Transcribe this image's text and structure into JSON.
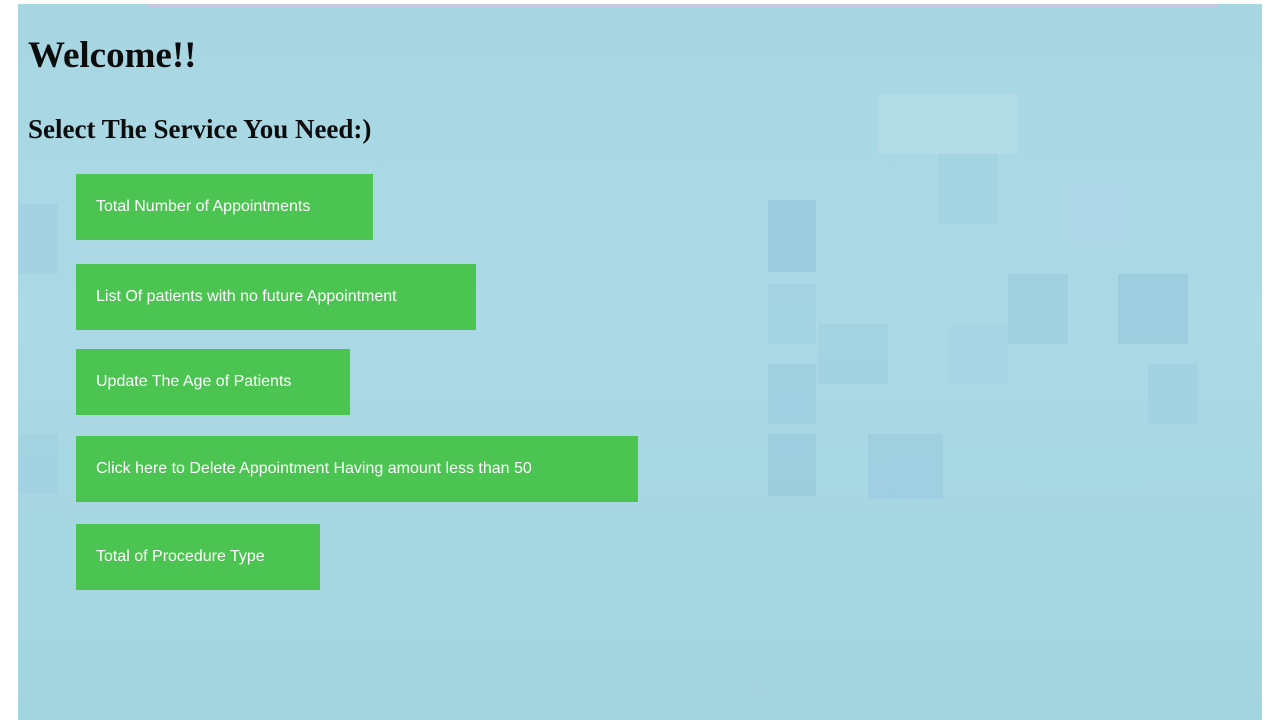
{
  "page": {
    "heading": "Welcome!!",
    "subheading": "Select The Service You Need:)"
  },
  "services": [
    {
      "label": "Total Number of Appointments"
    },
    {
      "label": "List Of patients with no future Appointment"
    },
    {
      "label": "Update The Age of Patients"
    },
    {
      "label": "Click here to Delete Appointment Having amount less than 50"
    },
    {
      "label": "Total of Procedure Type"
    }
  ],
  "colors": {
    "background": "#a8d6e2",
    "button": "#4cc452",
    "button_text": "#ffffff",
    "heading_text": "#0c0c0c"
  }
}
